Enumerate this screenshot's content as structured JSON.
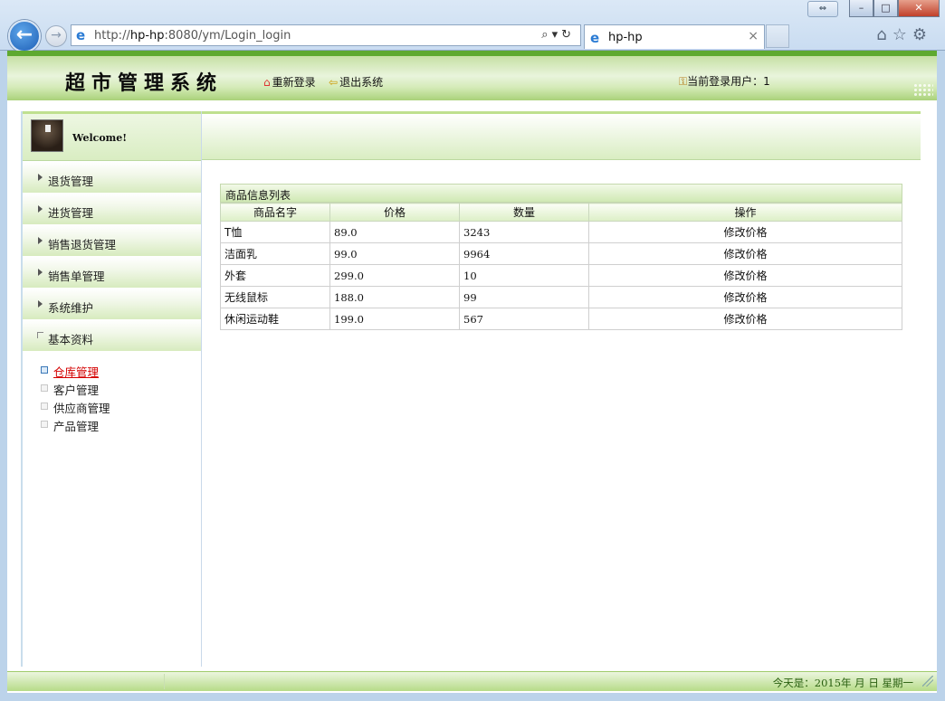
{
  "browser": {
    "url_prefix": "http://",
    "url_host": "hp-hp",
    "url_rest": ":8080/ym/Login_login",
    "tab_title": "hp-hp",
    "url_tools": "⌕▾↻",
    "tab_close": "×",
    "nav_back": "←",
    "nav_forward": "→",
    "right_icons": "⌂☆⚙"
  },
  "header": {
    "logo": "超市管理系统",
    "relogin_label": "重新登录",
    "logout_label": "退出系统",
    "current_user_label": "当前登录用户：1",
    "icons": {
      "relogin": "home-icon",
      "logout": "exit-icon",
      "user": "user-icon"
    }
  },
  "sidebar": {
    "welcome": "Welcome!",
    "menu": [
      {
        "label": "退货管理"
      },
      {
        "label": "进货管理"
      },
      {
        "label": "销售退货管理"
      },
      {
        "label": "销售单管理"
      },
      {
        "label": "系统维护"
      },
      {
        "label": "基本资料"
      }
    ],
    "submenu": [
      {
        "label": "仓库管理",
        "active": true
      },
      {
        "label": "客户管理"
      },
      {
        "label": "供应商管理"
      },
      {
        "label": "产品管理"
      }
    ]
  },
  "table": {
    "caption": "商品信息列表",
    "headers": [
      "商品名字",
      "价格",
      "数量",
      "操作"
    ],
    "rows": [
      {
        "name": "T恤",
        "price": "89.0",
        "qty": "3243",
        "action": "修改价格"
      },
      {
        "name": "洁面乳",
        "price": "99.0",
        "qty": "9964",
        "action": "修改价格"
      },
      {
        "name": "外套",
        "price": "299.0",
        "qty": "10",
        "action": "修改价格"
      },
      {
        "name": "无线鼠标",
        "price": "188.0",
        "qty": "99",
        "action": "修改价格"
      },
      {
        "name": "休闲运动鞋",
        "price": "199.0",
        "qty": "567",
        "action": "修改价格"
      }
    ]
  },
  "footer": {
    "date_text": "今天是：2015年 月 日  星期一"
  },
  "colors": {
    "accent": "#5ea930",
    "active_link": "#d40000",
    "ie_blue": "#2a7bd4"
  }
}
